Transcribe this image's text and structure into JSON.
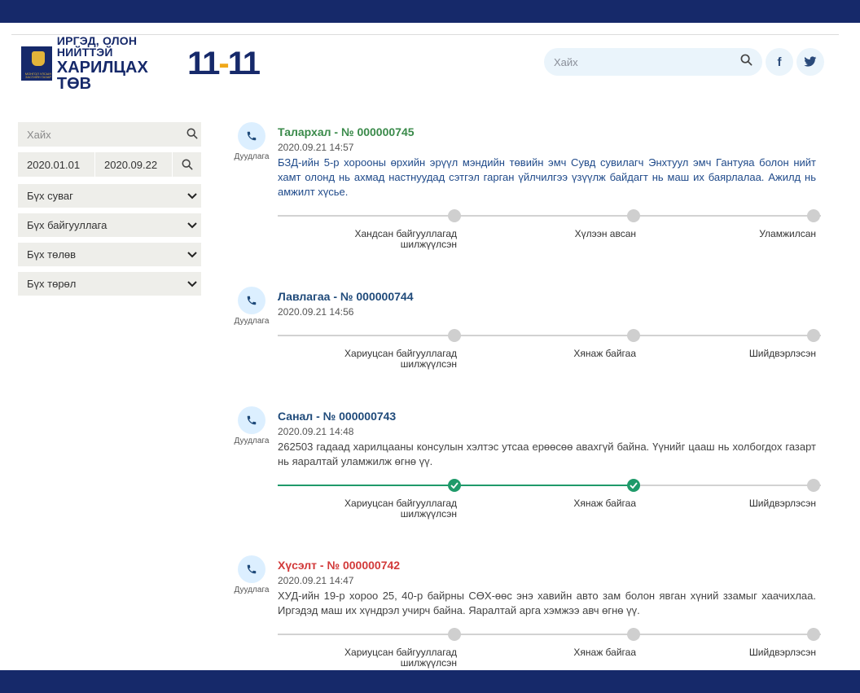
{
  "header": {
    "logo_emblem_text": "МОНГОЛ УЛСЫН ЗАСГИЙН ГАЗАР",
    "logo_line1": "ИРГЭД, ОЛОН НИЙТТЭЙ",
    "logo_line2": "ХАРИЛЦАХ ТӨВ",
    "logo_num_a": "11",
    "logo_num_dash": "-",
    "logo_num_b": "11",
    "search_placeholder": "Хайх",
    "facebook_label": "f"
  },
  "colors": {
    "topbar": "#16296a",
    "accent_done": "#1f9a6a",
    "title_green": "#3a8a4a",
    "title_navy": "#1f4a7a",
    "title_red": "#d23a3a"
  },
  "sidebar": {
    "search_placeholder": "Хайх",
    "date_from": "2020.01.01",
    "date_to": "2020.09.22",
    "filters": [
      "Бүх суваг",
      "Бүх байгууллага",
      "Бүх төлөв",
      "Бүх төрөл"
    ]
  },
  "items": [
    {
      "title": "Талархал - № 000000745",
      "date": "2020.09.21 14:57",
      "channel": "Дуудлага",
      "description": "БЗД-ийн 5-р хорооны өрхийн эрүүл мэндийн төвийн эмч Сувд сувилагч Энхтуул эмч Гантуяа болон нийт хамт олонд нь ахмад настнуудад сэтгэл гарган үйлчилгээ үзүүлж байдагт нь маш их баярлалаа. Ажилд нь амжилт хүсье.",
      "steps": [
        "Хандсан байгууллагад шилжүүлсэн",
        "Хүлээн авсан",
        "Уламжилсан"
      ],
      "progress": 0
    },
    {
      "title": "Лавлагаа - № 000000744",
      "date": "2020.09.21 14:56",
      "channel": "Дуудлага",
      "description": "",
      "steps": [
        "Хариуцсан байгууллагад шилжүүлсэн",
        "Хянаж байгаа",
        "Шийдвэрлэсэн"
      ],
      "progress": 0
    },
    {
      "title": "Санал - № 000000743",
      "date": "2020.09.21 14:48",
      "channel": "Дуудлага",
      "description": "262503 гадаад харилцааны консулын хэлтэс утсаа ерөөсөө авахгүй байна. Үүнийг цааш нь холбогдох газарт нь яаралтай уламжилж өгнө үү.",
      "steps": [
        "Хариуцсан байгууллагад шилжүүлсэн",
        "Хянаж байгаа",
        "Шийдвэрлэсэн"
      ],
      "progress": 2
    },
    {
      "title": "Хүсэлт - № 000000742",
      "date": "2020.09.21 14:47",
      "channel": "Дуудлага",
      "description": "ХУД-ийн 19-р хороо 25, 40-р байрны СӨХ-өөс энэ хавийн авто зам болон явган хүний ззамыг хаачихлаа. Иргэдэд маш их хүндрэл учирч байна. Яаралтай арга хэмжээ авч өгнө үү.",
      "steps": [
        "Хариуцсан байгууллагад шилжүүлсэн",
        "Хянаж байгаа",
        "Шийдвэрлэсэн"
      ],
      "progress": 0
    }
  ]
}
